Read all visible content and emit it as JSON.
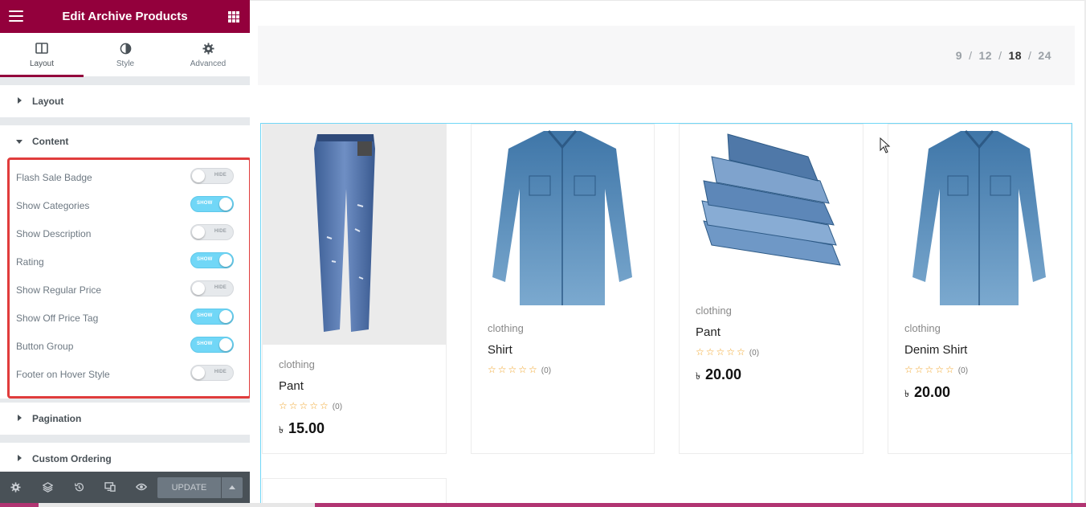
{
  "editor": {
    "title": "Edit Archive Products",
    "tabs": [
      {
        "label": "Layout",
        "icon": "columns-icon"
      },
      {
        "label": "Style",
        "icon": "contrast-icon"
      },
      {
        "label": "Advanced",
        "icon": "gear-icon"
      }
    ],
    "sections": {
      "layout": "Layout",
      "content": "Content",
      "pagination": "Pagination",
      "ordering": "Custom Ordering"
    },
    "controls": [
      {
        "label": "Flash Sale Badge",
        "state": "HIDE"
      },
      {
        "label": "Show Categories",
        "state": "SHOW"
      },
      {
        "label": "Show Description",
        "state": "HIDE"
      },
      {
        "label": "Rating",
        "state": "SHOW"
      },
      {
        "label": "Show Regular Price",
        "state": "HIDE"
      },
      {
        "label": "Show Off Price Tag",
        "state": "SHOW"
      },
      {
        "label": "Button Group",
        "state": "SHOW"
      },
      {
        "label": "Footer on Hover Style",
        "state": "HIDE"
      }
    ],
    "footer": {
      "update_label": "UPDATE"
    },
    "colors": {
      "brand": "#93003c",
      "toggle_on": "#71d7f7",
      "highlight": "#e03c3c"
    }
  },
  "preview": {
    "per_page": [
      "9",
      "12",
      "18",
      "24"
    ],
    "per_page_active": "18",
    "products": [
      {
        "category": "clothing",
        "name": "Pant",
        "rating_count": "(0)",
        "currency": "৳",
        "price": "15.00",
        "image": "jeans-image"
      },
      {
        "category": "clothing",
        "name": "Shirt",
        "rating_count": "(0)",
        "image": "denim-shirt-image"
      },
      {
        "category": "clothing",
        "name": "Pant",
        "rating_count": "(0)",
        "currency": "৳",
        "price": "20.00",
        "image": "folded-jeans-image"
      },
      {
        "category": "clothing",
        "name": "Denim Shirt",
        "rating_count": "(0)",
        "currency": "৳",
        "price": "20.00",
        "image": "denim-shirt-image"
      }
    ],
    "stars": "☆☆☆☆☆"
  }
}
